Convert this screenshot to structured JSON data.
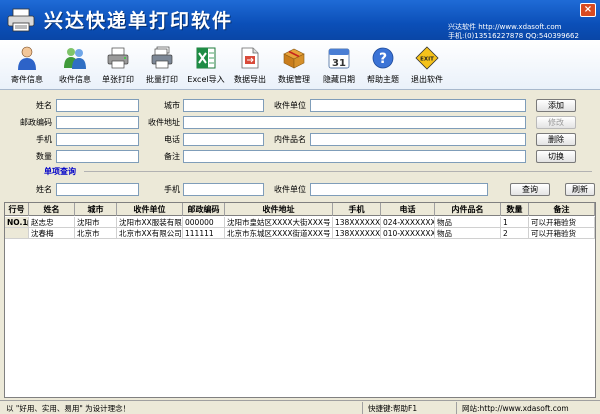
{
  "window": {
    "title": "兴达快递单打印软件",
    "company": "兴达软件  http://www.xdasoft.com",
    "contact": "手机:(0)13516227878 QQ:540399662",
    "close": "×"
  },
  "toolbar": [
    {
      "id": "sender",
      "label": "寄件信息",
      "icon": "person-icon"
    },
    {
      "id": "receiver",
      "label": "收件信息",
      "icon": "people-icon"
    },
    {
      "id": "single-print",
      "label": "单张打印",
      "icon": "printer-icon"
    },
    {
      "id": "batch-print",
      "label": "批量打印",
      "icon": "batch-printer-icon"
    },
    {
      "id": "excel-import",
      "label": "Excel导入",
      "icon": "excel-icon"
    },
    {
      "id": "data-export",
      "label": "数据导出",
      "icon": "export-icon"
    },
    {
      "id": "data-manage",
      "label": "数据管理",
      "icon": "box-icon"
    },
    {
      "id": "hide-date",
      "label": "隐藏日期",
      "icon": "calendar-icon"
    },
    {
      "id": "help",
      "label": "帮助主题",
      "icon": "help-icon"
    },
    {
      "id": "exit",
      "label": "退出软件",
      "icon": "exit-icon"
    }
  ],
  "calendar_day": "31",
  "exit_sign": "EXIT",
  "form": {
    "name": "姓名",
    "city": "城市",
    "receiver_unit": "收件单位",
    "postcode": "邮政编码",
    "receiver_address": "收件地址",
    "mobile": "手机",
    "phone": "电话",
    "goods_name": "内件品名",
    "quantity": "数量",
    "remark": "备注"
  },
  "buttons": {
    "add": "添加",
    "edit": "修改",
    "delete": "删除",
    "switch": "切换",
    "query": "查询",
    "refresh": "刷新"
  },
  "query": {
    "section_title": "单项查询",
    "name": "姓名",
    "mobile": "手机",
    "receiver_unit": "收件单位"
  },
  "table": {
    "headers": [
      "行号",
      "姓名",
      "城市",
      "收件单位",
      "邮政编码",
      "收件地址",
      "手机",
      "电话",
      "内件品名",
      "数量",
      "备注"
    ],
    "rows": [
      [
        "NO.1▶",
        "赵志忠",
        "沈阳市",
        "沈阳市XX服装有限",
        "000000",
        "沈阳市皇姑区XXXX大街XXX号",
        "138XXXXXXX0",
        "024-XXXXXXXX",
        "物品",
        "1",
        "可以开箱验货"
      ],
      [
        "",
        "沈春梅",
        "北京市",
        "北京市XX有限公司",
        "111111",
        "北京市东城区XXXX街道XXX号",
        "138XXXXXXX1",
        "010-XXXXXXXX",
        "物品",
        "2",
        "可以开箱验货"
      ]
    ]
  },
  "status": {
    "slogan": "以 \"好用、实用、易用\" 为设计理念！",
    "hotkey": "快捷键:帮助F1",
    "website": "网站:http://www.xdasoft.com"
  }
}
